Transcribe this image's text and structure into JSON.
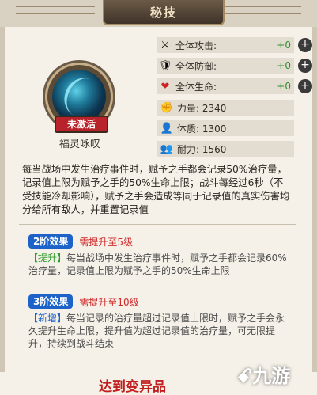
{
  "header": {
    "title": "秘技"
  },
  "skill": {
    "status_badge": "未激活",
    "name": "福灵咏叹"
  },
  "stats": [
    {
      "icon": "sword-icon",
      "label": "全体攻击:",
      "value": "+0"
    },
    {
      "icon": "shield-icon",
      "label": "全体防御:",
      "value": "+0"
    },
    {
      "icon": "heart-icon",
      "label": "全体生命:",
      "value": "+0"
    }
  ],
  "attributes": [
    {
      "icon": "strength-icon",
      "label": "力量: 2340"
    },
    {
      "icon": "constitution-icon",
      "label": "体质: 1300"
    },
    {
      "icon": "endurance-icon",
      "label": "耐力: 1560"
    }
  ],
  "description": "每当战场中发生治疗事件时，赋予之手都会记录50%治疗量，记录值上限为赋予之手的50%生命上限；战斗每经过6秒（不受技能冷却影响），赋予之手会造成等同于记录值的真实伤害均分给所有敌人，并重置记录值",
  "levels": [
    {
      "label": "2阶效果",
      "requirement": "需提升至5级",
      "tag": "【提升】",
      "text": "每当战场中发生治疗事件时，赋予之手都会记录60%治疗量，记录值上限为赋予之手的50%生命上限"
    },
    {
      "label": "3阶效果",
      "requirement": "需提升至10级",
      "tag": "【新增】",
      "text": "每当记录的治疗量超过记录值上限时，赋予之手会永久提升生命上限，提升值为超过记录值的治疗量，可无限提升，持续到战斗结束"
    }
  ],
  "footer": {
    "text": "达到变异品"
  },
  "watermark": {
    "text": "九游"
  },
  "colors": {
    "accent_red": "#c22020",
    "pill_blue": "#1d62c9",
    "stat_green": "#2f8f2c"
  }
}
